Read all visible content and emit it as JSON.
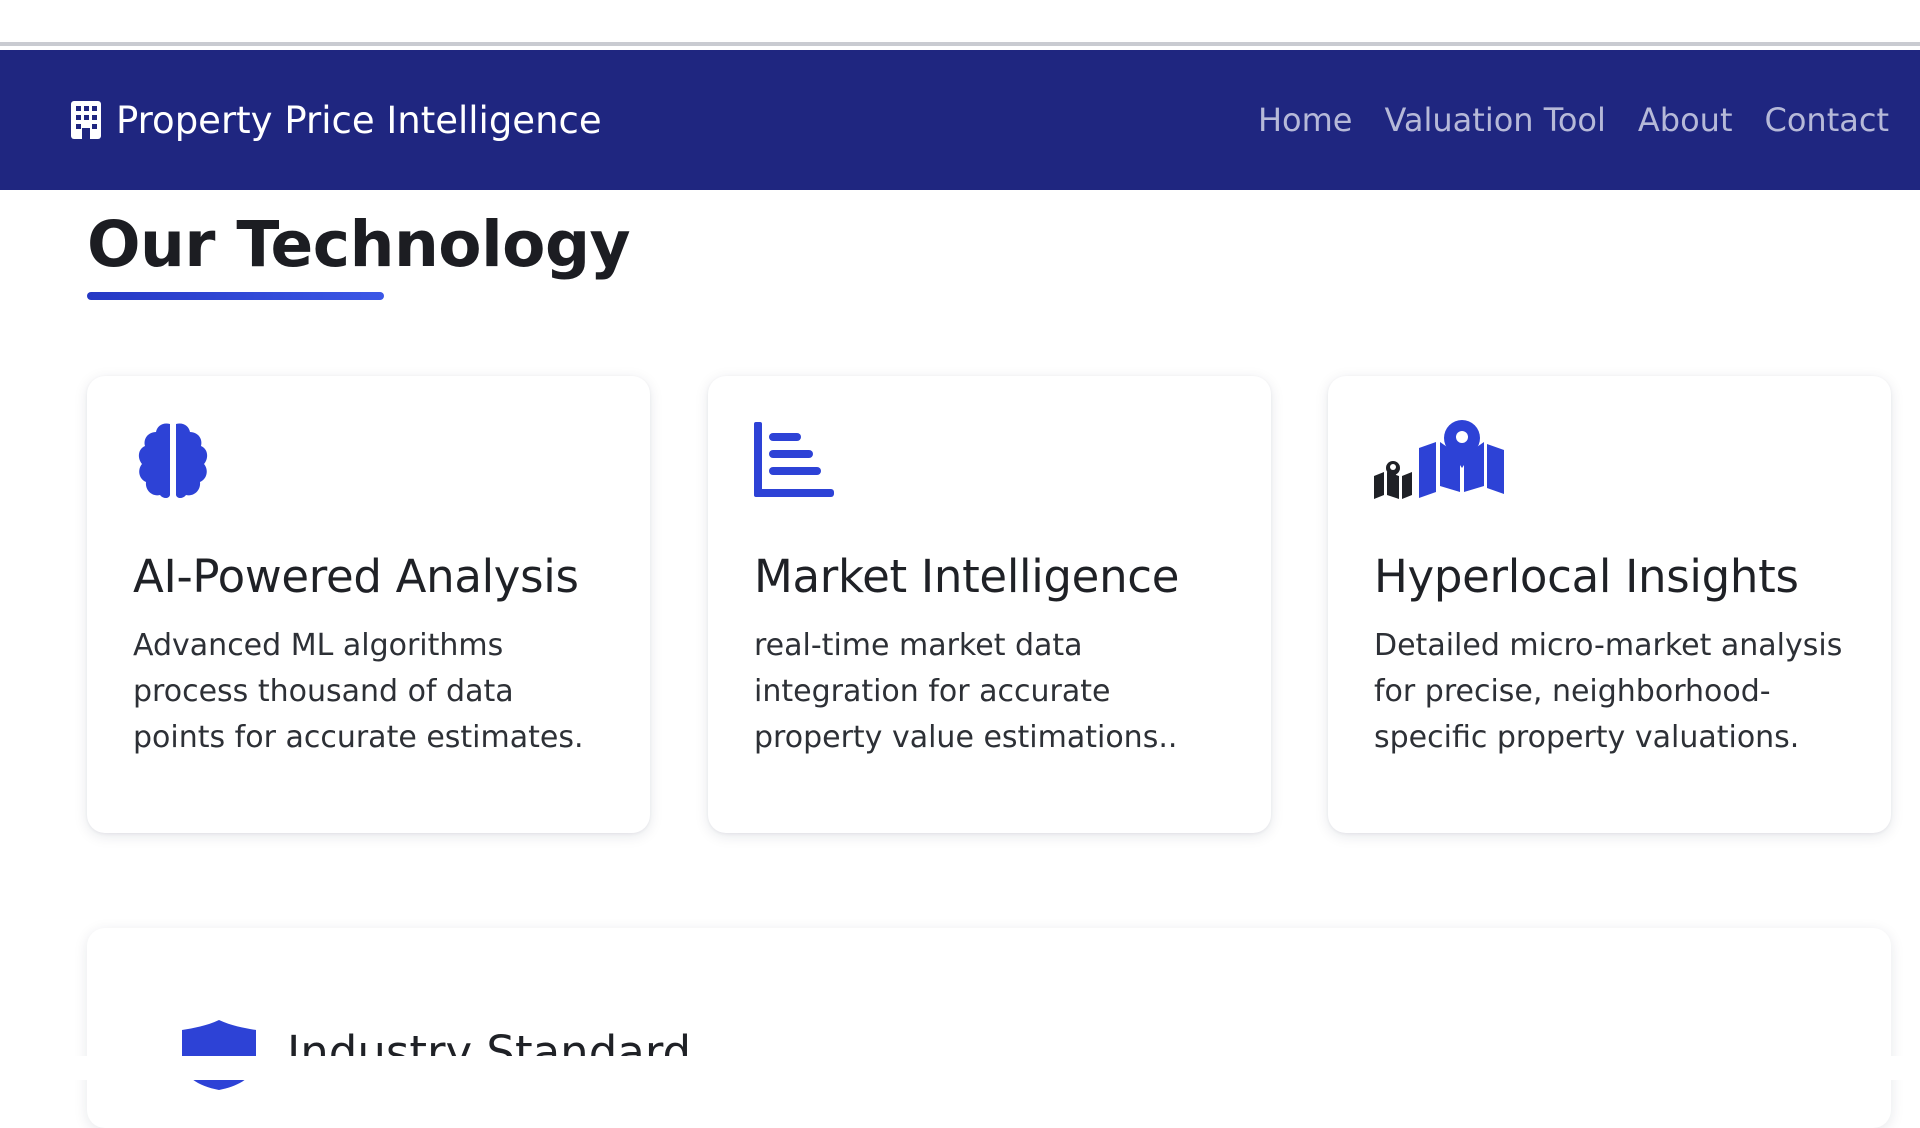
{
  "navbar": {
    "brand_icon": "building-icon",
    "brand_text": "Property Price Intelligence",
    "links": [
      "Home",
      "Valuation Tool",
      "About",
      "Contact"
    ],
    "bg_color": "#1f2680"
  },
  "section": {
    "title": "Our Technology",
    "accent_color": "#2d42d6"
  },
  "cards": [
    {
      "icon": "brain-icon",
      "title": "AI-Powered Analysis",
      "desc": "Advanced ML algorithms process thousand of data points for accurate estimates."
    },
    {
      "icon": "chart-bar-icon",
      "title": "Market Intelligence",
      "desc": "real-time market data integration for accurate property value estimations.."
    },
    {
      "icon": "map-location-icon",
      "title": "Hyperlocal Insights",
      "desc": "Detailed micro-market analysis for precise, neighborhood-specific property valuations."
    }
  ],
  "next_card": {
    "icon": "shield-icon",
    "title": "Industry Standard"
  }
}
